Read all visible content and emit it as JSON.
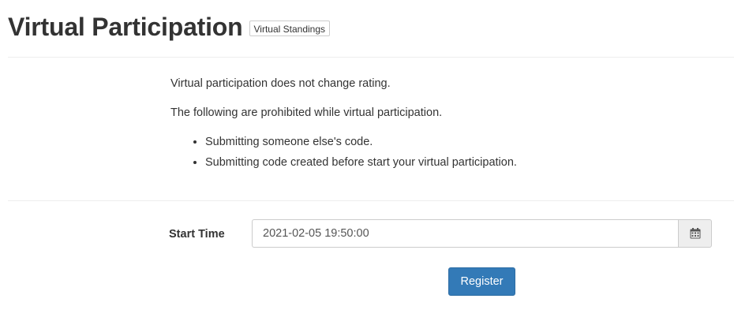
{
  "header": {
    "title": "Virtual Participation",
    "standings_button": "Virtual Standings"
  },
  "notes": {
    "line1": "Virtual participation does not change rating.",
    "line2": "The following are prohibited while virtual participation.",
    "prohibited": [
      "Submitting someone else's code.",
      "Submitting code created before start your virtual participation."
    ]
  },
  "form": {
    "start_time_label": "Start Time",
    "start_time_value": "2021-02-05 19:50:00",
    "calendar_icon": "calendar-icon",
    "register_label": "Register"
  },
  "colors": {
    "primary": "#337ab7",
    "text": "#333333",
    "divider": "#eeeeee"
  }
}
